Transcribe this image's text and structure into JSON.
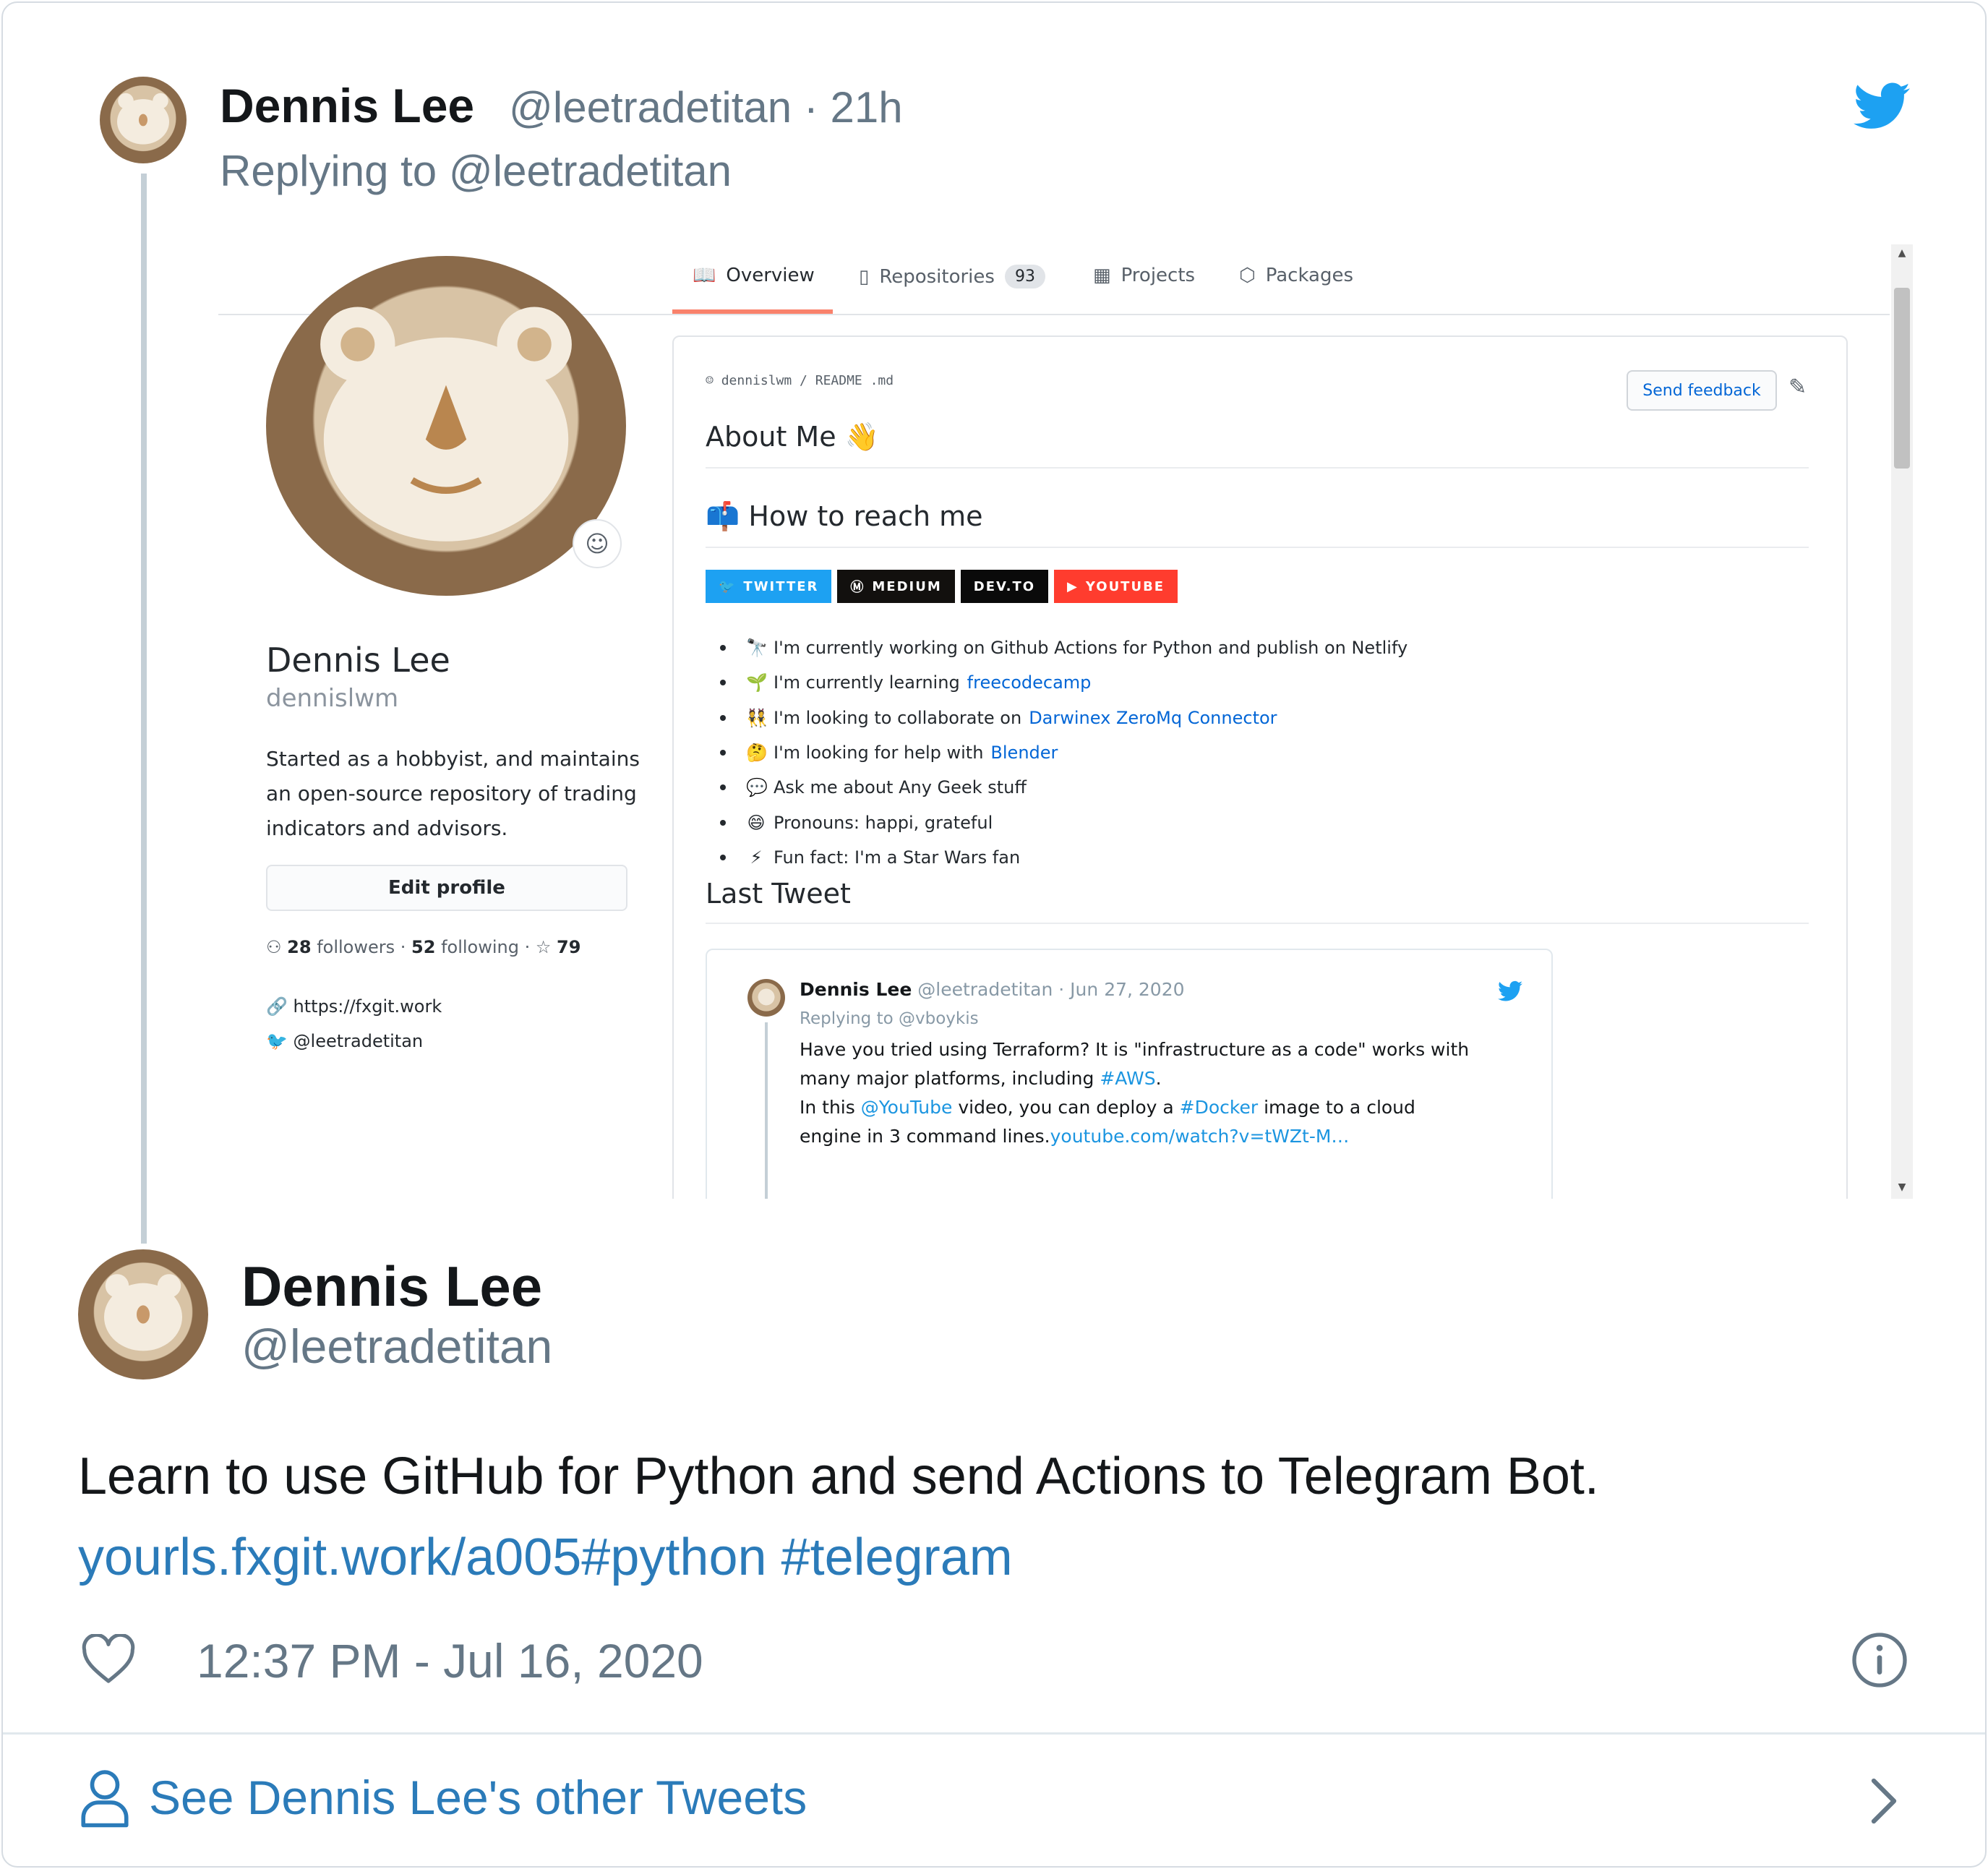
{
  "parent_tweet": {
    "author_name": "Dennis Lee",
    "author_handle_time": "@leetradetitan · 21h",
    "replying_to": "Replying to @leetradetitan"
  },
  "github_profile": {
    "tabs": [
      {
        "label": "Overview"
      },
      {
        "label": "Repositories",
        "count": "93"
      },
      {
        "label": "Projects"
      },
      {
        "label": "Packages"
      }
    ],
    "name": "Dennis Lee",
    "login": "dennislwm",
    "bio": "Started as a hobbyist, and maintains an open-source repository of trading indicators and advisors.",
    "edit_button": "Edit profile",
    "followers": "28",
    "followers_label": "followers",
    "following": "52",
    "following_label": "following",
    "stars": "79",
    "website": "https://fxgit.work",
    "twitter": "@leetradetitan",
    "readme_path": "dennislwm / README .md",
    "send_feedback": "Send feedback",
    "about_heading": "About Me",
    "reach_heading": "How to reach me",
    "badges": [
      {
        "label": "TWITTER",
        "color": "#1da1f2"
      },
      {
        "label": "MEDIUM",
        "color": "#12100e"
      },
      {
        "label": "DEV.TO",
        "color": "#0a0a0a"
      },
      {
        "label": "YOUTUBE",
        "color": "#ff3c2e"
      }
    ],
    "list": [
      {
        "icon": "🔭",
        "text": "I'm currently working on Github Actions for Python and publish on Netlify",
        "link": ""
      },
      {
        "icon": "🌱",
        "text": "I'm currently learning ",
        "link": "freecodecamp"
      },
      {
        "icon": "👯",
        "text": "I'm looking to collaborate on ",
        "link": "Darwinex ZeroMq Connector"
      },
      {
        "icon": "🤔",
        "text": "I'm looking for help with ",
        "link": "Blender"
      },
      {
        "icon": "💬",
        "text": "Ask me about Any Geek stuff",
        "link": ""
      },
      {
        "icon": "😄",
        "text": "Pronouns: happi, grateful",
        "link": ""
      },
      {
        "icon": "⚡",
        "text": "Fun fact: I'm a Star Wars fan",
        "link": ""
      }
    ],
    "last_tweet_heading": "Last Tweet",
    "embedded_tweet": {
      "name": "Dennis Lee",
      "meta": "@leetradetitan · Jun 27, 2020",
      "replying_to": "Replying to @vboykis",
      "line1": "Have you tried using Terraform? It is \"infrastructure as a code\" works with",
      "line2a": "many major platforms, including ",
      "line2b": "#AWS",
      "line2c": ".",
      "line3a": "In this ",
      "line3b": "@YouTube",
      "line3c": " video, you can deploy a ",
      "line3d": "#Docker",
      "line3e": " image to  a cloud",
      "line4a": "engine in 3 command lines.",
      "line4b": "youtube.com/watch?v=tWZt-M…"
    }
  },
  "main_tweet": {
    "author_name": "Dennis Lee",
    "author_handle": "@leetradetitan",
    "text": "Learn to use GitHub for Python and send Actions to Telegram Bot.",
    "link": "yourls.fxgit.work/a005#python",
    "hashtag": "#telegram",
    "timestamp": "12:37 PM - Jul 16, 2020"
  },
  "footer": {
    "see_other": "See Dennis Lee's other Tweets"
  },
  "colors": {
    "twitter_blue": "#1da1f2",
    "link_blue": "#2b7bb9",
    "muted": "#657786",
    "github_link": "#0366d6"
  }
}
